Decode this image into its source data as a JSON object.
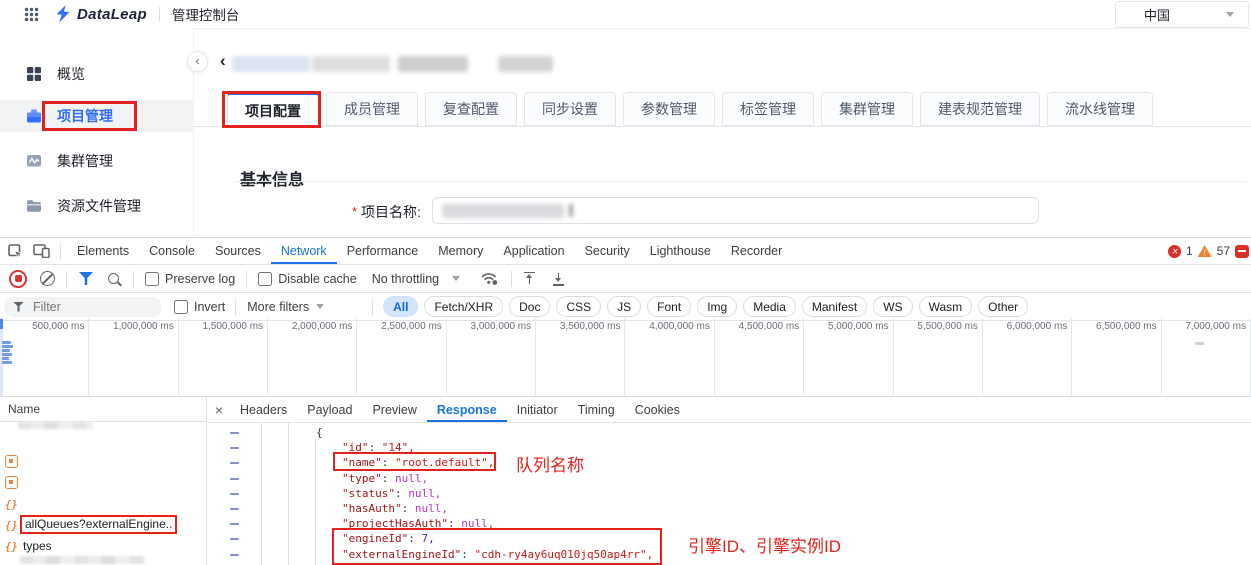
{
  "topbar": {
    "brand": "DataLeap",
    "console_title": "管理控制台",
    "region": "中国"
  },
  "sidebar": {
    "items": [
      {
        "label": "概览"
      },
      {
        "label": "项目管理"
      },
      {
        "label": "集群管理"
      },
      {
        "label": "资源文件管理"
      }
    ]
  },
  "content": {
    "tabs": [
      {
        "label": "项目配置",
        "state": "active"
      },
      {
        "label": "成员管理",
        "state": ""
      },
      {
        "label": "复查配置",
        "state": ""
      },
      {
        "label": "同步设置",
        "state": ""
      },
      {
        "label": "参数管理",
        "state": ""
      },
      {
        "label": "标签管理",
        "state": ""
      },
      {
        "label": "集群管理",
        "state": ""
      },
      {
        "label": "建表规范管理",
        "state": ""
      },
      {
        "label": "流水线管理",
        "state": ""
      }
    ],
    "section_title": "基本信息",
    "form": {
      "required_mark": "*",
      "project_name_label": "项目名称:"
    }
  },
  "devtools": {
    "tabs": [
      {
        "label": "Elements",
        "state": ""
      },
      {
        "label": "Console",
        "state": ""
      },
      {
        "label": "Sources",
        "state": ""
      },
      {
        "label": "Network",
        "state": "active"
      },
      {
        "label": "Performance",
        "state": ""
      },
      {
        "label": "Memory",
        "state": ""
      },
      {
        "label": "Application",
        "state": ""
      },
      {
        "label": "Security",
        "state": ""
      },
      {
        "label": "Lighthouse",
        "state": ""
      },
      {
        "label": "Recorder",
        "state": ""
      }
    ],
    "badges": {
      "error_count": "1",
      "warning_count": "57"
    },
    "toolbar": {
      "preserve_log": "Preserve log",
      "disable_cache": "Disable cache",
      "throttling": "No throttling"
    },
    "filterbar": {
      "placeholder": "Filter",
      "invert": "Invert",
      "more_filters": "More filters",
      "pills": [
        {
          "label": "All",
          "state": "active"
        },
        {
          "label": "Fetch/XHR",
          "state": ""
        },
        {
          "label": "Doc",
          "state": ""
        },
        {
          "label": "CSS",
          "state": ""
        },
        {
          "label": "JS",
          "state": ""
        },
        {
          "label": "Font",
          "state": ""
        },
        {
          "label": "Img",
          "state": ""
        },
        {
          "label": "Media",
          "state": ""
        },
        {
          "label": "Manifest",
          "state": ""
        },
        {
          "label": "WS",
          "state": ""
        },
        {
          "label": "Wasm",
          "state": ""
        },
        {
          "label": "Other",
          "state": ""
        }
      ]
    },
    "timeline": {
      "labels": [
        "500,000 ms",
        "1,000,000 ms",
        "1,500,000 ms",
        "2,000,000 ms",
        "2,500,000 ms",
        "3,000,000 ms",
        "3,500,000 ms",
        "4,000,000 ms",
        "4,500,000 ms",
        "5,000,000 ms",
        "5,500,000 ms",
        "6,000,000 ms",
        "6,500,000 ms",
        "7,000,000 ms"
      ]
    },
    "network": {
      "name_header": "Name",
      "rows": [
        {
          "icon": "",
          "label": "",
          "state": "redacted"
        },
        {
          "icon": "icon-square",
          "label": "",
          "state": "redacted"
        },
        {
          "icon": "icon-square",
          "label": "",
          "state": "redacted"
        },
        {
          "icon": "icon-braces",
          "label": "",
          "state": "redacted"
        },
        {
          "icon": "icon-braces",
          "label": "allQueues?externalEngine..",
          "state": "boxed"
        },
        {
          "icon": "icon-braces",
          "label": "types",
          "state": ""
        }
      ]
    },
    "response": {
      "close": "×",
      "tabs": [
        {
          "label": "Headers",
          "state": ""
        },
        {
          "label": "Payload",
          "state": ""
        },
        {
          "label": "Preview",
          "state": ""
        },
        {
          "label": "Response",
          "state": "active"
        },
        {
          "label": "Initiator",
          "state": ""
        },
        {
          "label": "Timing",
          "state": ""
        },
        {
          "label": "Cookies",
          "state": ""
        }
      ],
      "lines": [
        {
          "k": "",
          "s": "",
          "v": "{",
          "vt": "pln",
          "ind": "i3"
        },
        {
          "k": "\"id\"",
          "s": ": ",
          "v": "\"14\",",
          "vt": "str",
          "ind": "i4"
        },
        {
          "k": "\"name\"",
          "s": ": ",
          "v": "\"root.default\",",
          "vt": "str",
          "ind": "i4"
        },
        {
          "k": "\"type\"",
          "s": ": ",
          "v": "null,",
          "vt": "nul",
          "ind": "i4"
        },
        {
          "k": "\"status\"",
          "s": ": ",
          "v": "null,",
          "vt": "nul",
          "ind": "i4"
        },
        {
          "k": "\"hasAuth\"",
          "s": ": ",
          "v": "null,",
          "vt": "nul",
          "ind": "i4"
        },
        {
          "k": "\"projectHasAuth\"",
          "s": ": ",
          "v": "null,",
          "vt": "nul",
          "ind": "i4"
        },
        {
          "k": "\"engineId\"",
          "s": ": ",
          "v": "7,",
          "vt": "num",
          "ind": "i4"
        },
        {
          "k": "\"externalEngineId\"",
          "s": ": ",
          "v": "\"cdh-ry4ay6uq010jq50ap4rr\",",
          "vt": "str",
          "ind": "i4"
        }
      ]
    },
    "annotations": {
      "queue_name": "队列名称",
      "engine_ids": "引擎ID、引擎实例ID"
    }
  },
  "colors": {
    "app_accent": "#336df4",
    "devtools_accent": "#1a73e8",
    "annotation_red": "#e0231d",
    "request_icon_orange": "#e8853d"
  }
}
